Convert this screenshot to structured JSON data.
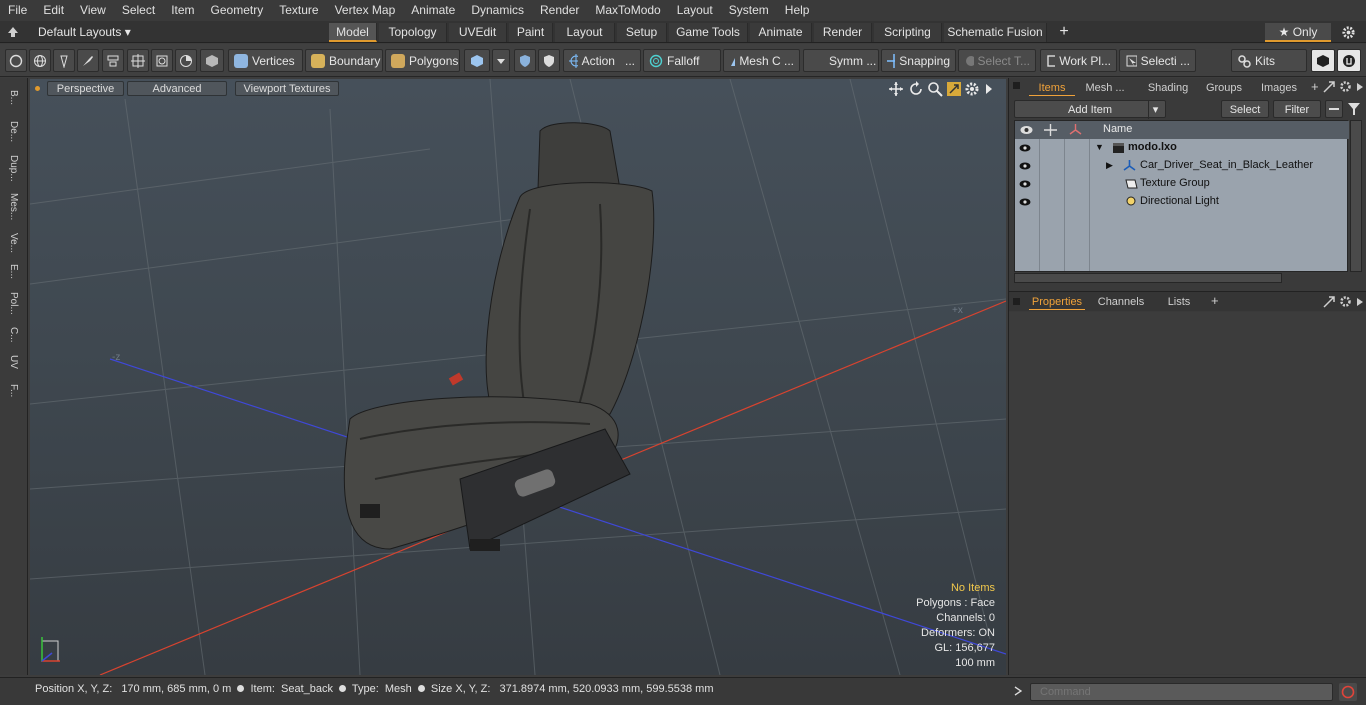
{
  "menu": [
    "File",
    "Edit",
    "View",
    "Select",
    "Item",
    "Geometry",
    "Texture",
    "Vertex Map",
    "Animate",
    "Dynamics",
    "Render",
    "MaxToModo",
    "Layout",
    "System",
    "Help"
  ],
  "layouts": {
    "label": "Default Layouts ▾"
  },
  "mode_tabs": [
    "Model",
    "Topology",
    "UVEdit",
    "Paint",
    "Layout",
    "Setup",
    "Game Tools",
    "Animate",
    "Render",
    "Scripting",
    "Schematic Fusion"
  ],
  "mode_tab_add": "+",
  "only_label": "★ Only",
  "toolbar": {
    "vertices": "Vertices",
    "boundary": "Boundary",
    "polygons": "Polygons",
    "action": "Action",
    "action_more": "...",
    "falloff": "Falloff",
    "mesh": "Mesh C ...",
    "symm": "Symm ...",
    "snapping": "Snapping",
    "select_t": "Select T...",
    "workplane": "Work Pl...",
    "selecti": "Selecti ...",
    "kits": "Kits"
  },
  "left_tabs": [
    "B...",
    "De...",
    "Dup...",
    "Mes...",
    "Ve...",
    "E...",
    "Pol...",
    "C...",
    "UV",
    "F..."
  ],
  "viewport": {
    "perspective": "Perspective",
    "advanced": "Advanced",
    "textures": "Viewport Textures",
    "hud": {
      "no_items": "No Items",
      "polygons": "Polygons : Face",
      "channels": "Channels: 0",
      "deformers": "Deformers: ON",
      "gl": "GL: 156,677",
      "scale": "100 mm"
    },
    "axis_labels": {
      "neg_z": "-z",
      "pos_x": "+x"
    }
  },
  "right_tabs_top": [
    "Items",
    "Mesh ...",
    "Shading",
    "Groups",
    "Images"
  ],
  "add_item": "Add Item",
  "select_btn": "Select",
  "filter_btn": "Filter",
  "list_header": {
    "name": "Name"
  },
  "items": [
    {
      "name": "modo.lxo"
    },
    {
      "name": "Car_Driver_Seat_in_Black_Leather"
    },
    {
      "name": "Texture Group"
    },
    {
      "name": "Directional Light"
    }
  ],
  "right_tabs_bottom": [
    "Properties",
    "Channels",
    "Lists"
  ],
  "status": {
    "position_label": "Position X, Y, Z:",
    "position_value": "170 mm, 685 mm, 0 m",
    "item_label": "Item:",
    "item_value": "Seat_back",
    "type_label": "Type:",
    "type_value": "Mesh",
    "size_label": "Size X, Y, Z:",
    "size_value": "371.8974 mm, 520.0933 mm, 599.5538 mm"
  },
  "command_placeholder": "Command",
  "colors": {
    "accent": "#f0a23a",
    "x_axis": "#d8432f",
    "z_axis": "#3f48d8",
    "y_axis": "#39c43d"
  }
}
